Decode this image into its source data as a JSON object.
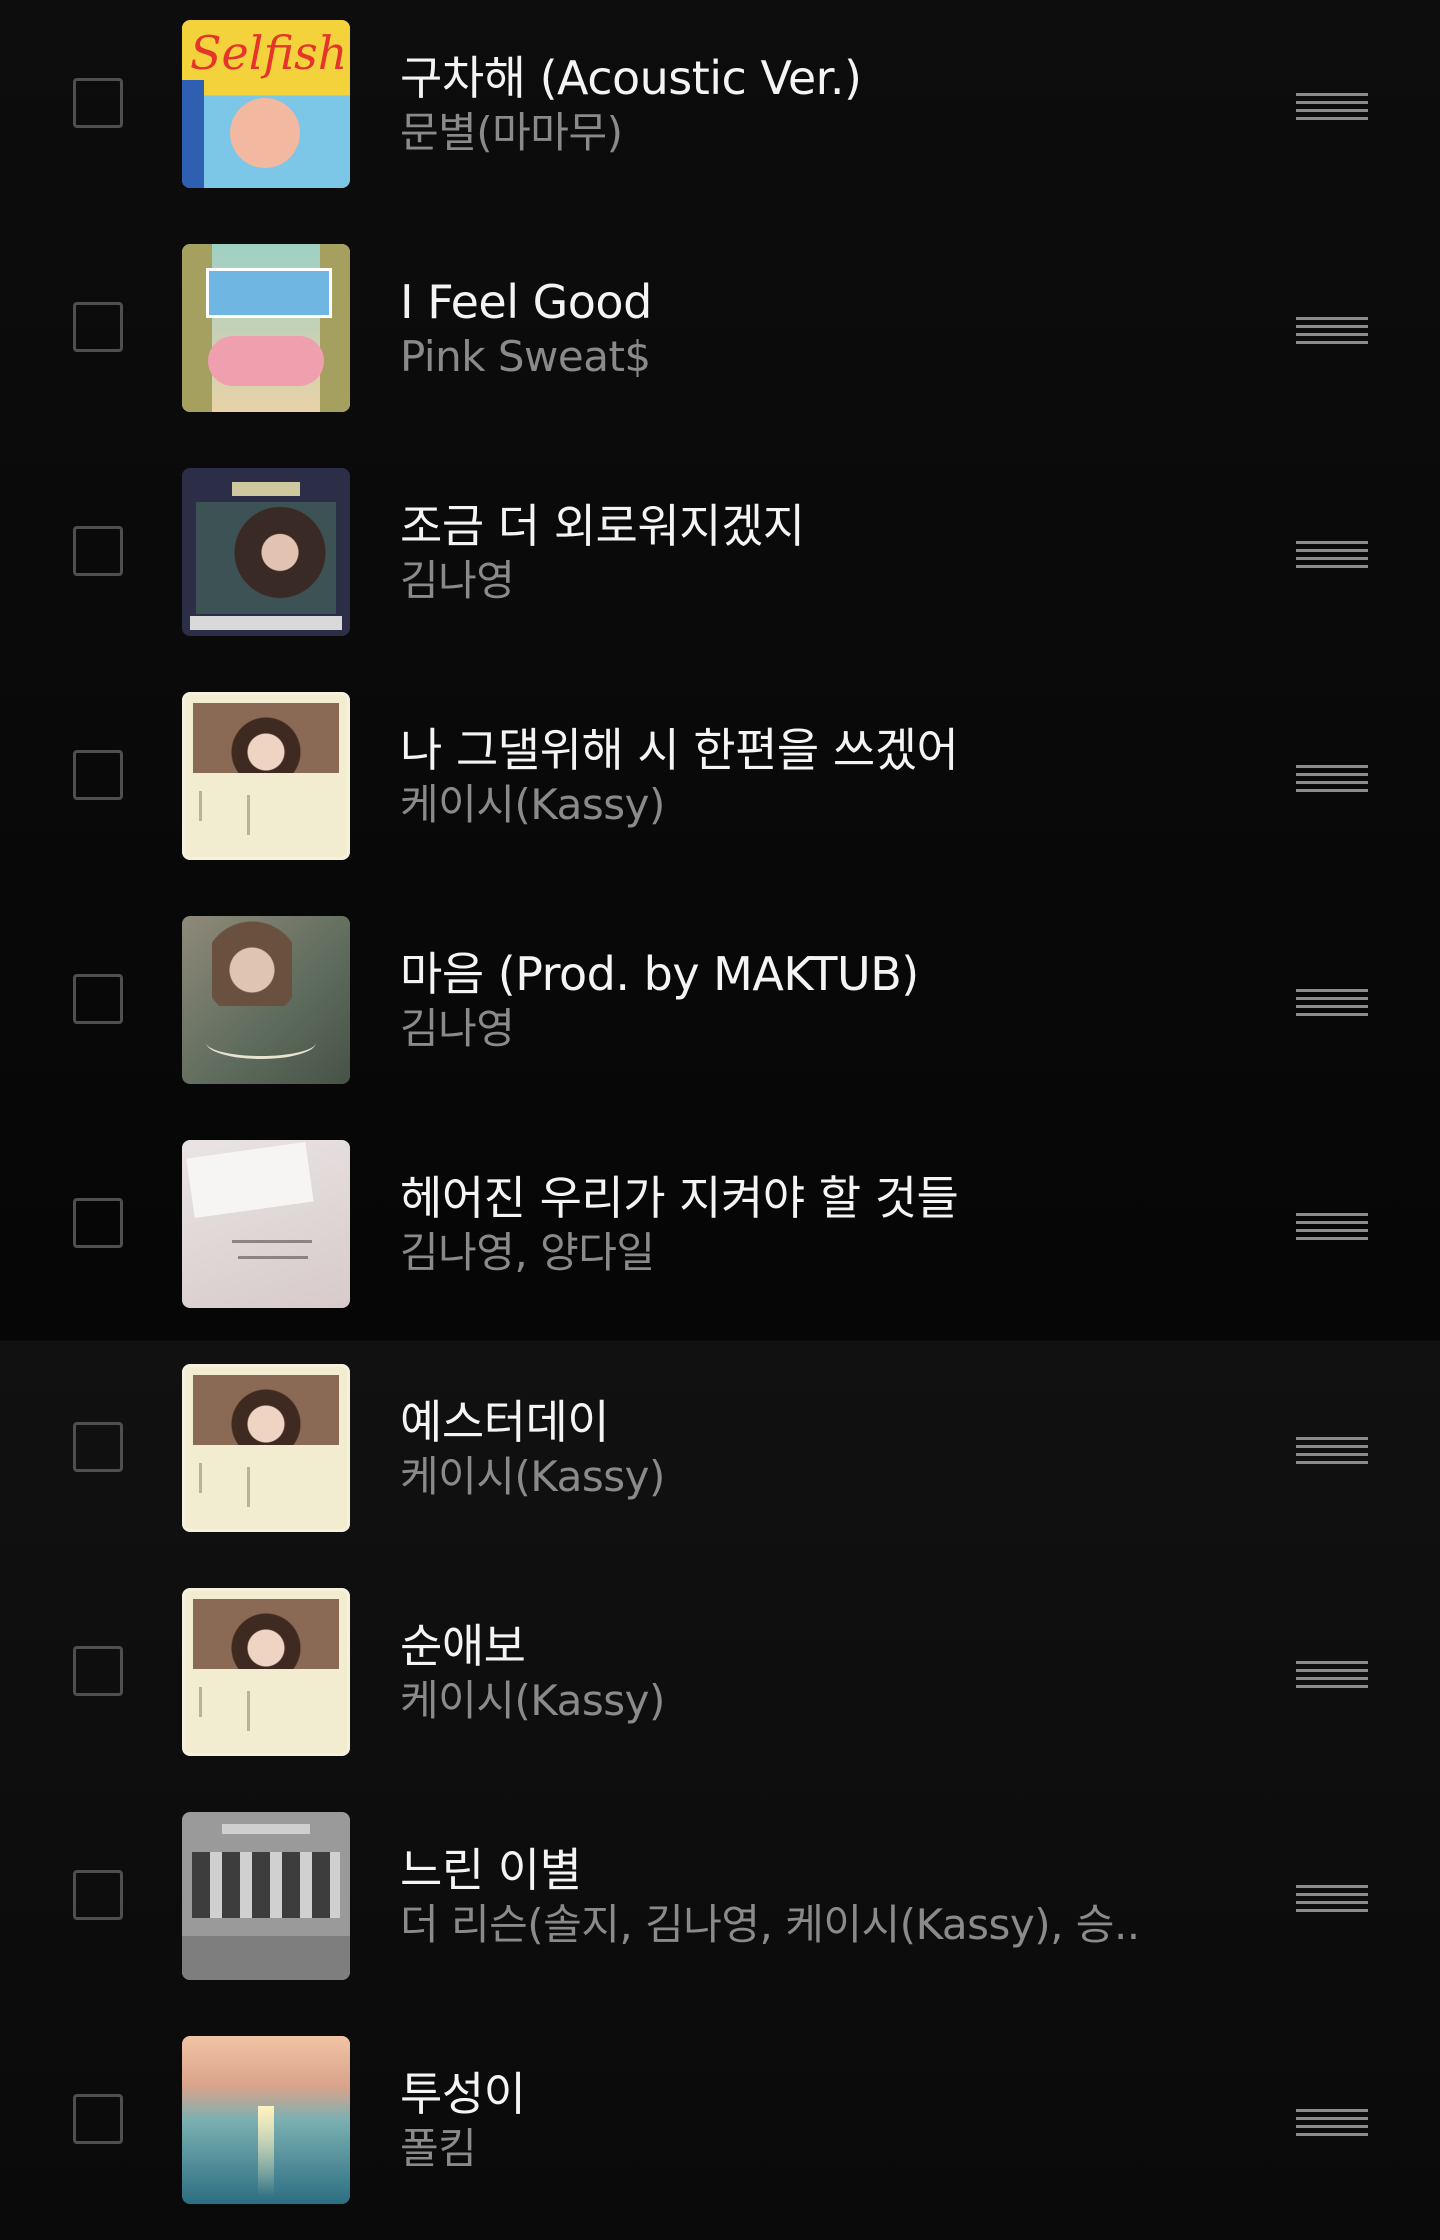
{
  "playlist": {
    "tracks": [
      {
        "title": "구차해 (Acoustic Ver.)",
        "artist": "문별(마마무)",
        "cover": "selfish",
        "cover_text": "Selfish"
      },
      {
        "title": "I Feel Good",
        "artist": "Pink Sweat$",
        "cover": "ifeel"
      },
      {
        "title": "조금 더 외로워지겠지",
        "artist": "김나영",
        "cover": "wwiw"
      },
      {
        "title": "나 그댈위해 시 한편을 쓰겠어",
        "artist": "케이시(Kassy)",
        "cover": "kassy"
      },
      {
        "title": "마음 (Prod. by MAKTUB)",
        "artist": "김나영",
        "cover": "maum"
      },
      {
        "title": "헤어진 우리가 지켜야 할 것들",
        "artist": "김나영, 양다일",
        "cover": "heyeo"
      },
      {
        "title": "예스터데이",
        "artist": "케이시(Kassy)",
        "cover": "kassy"
      },
      {
        "title": "순애보",
        "artist": "케이시(Kassy)",
        "cover": "kassy"
      },
      {
        "title": "느린 이별",
        "artist": "더 리슨(솔지, 김나영, 케이시(Kassy), 승...",
        "cover": "lesson"
      },
      {
        "title": "투성이",
        "artist": "폴킴",
        "cover": "tuseong"
      }
    ]
  },
  "icons": {
    "checkbox": "empty-square",
    "drag_handle": "four-horizontal-lines"
  },
  "colors": {
    "background": "#0b0b0b",
    "title": "#f4f4f4",
    "artist": "#8a8a8a",
    "checkbox_border": "#4f4f4f"
  }
}
